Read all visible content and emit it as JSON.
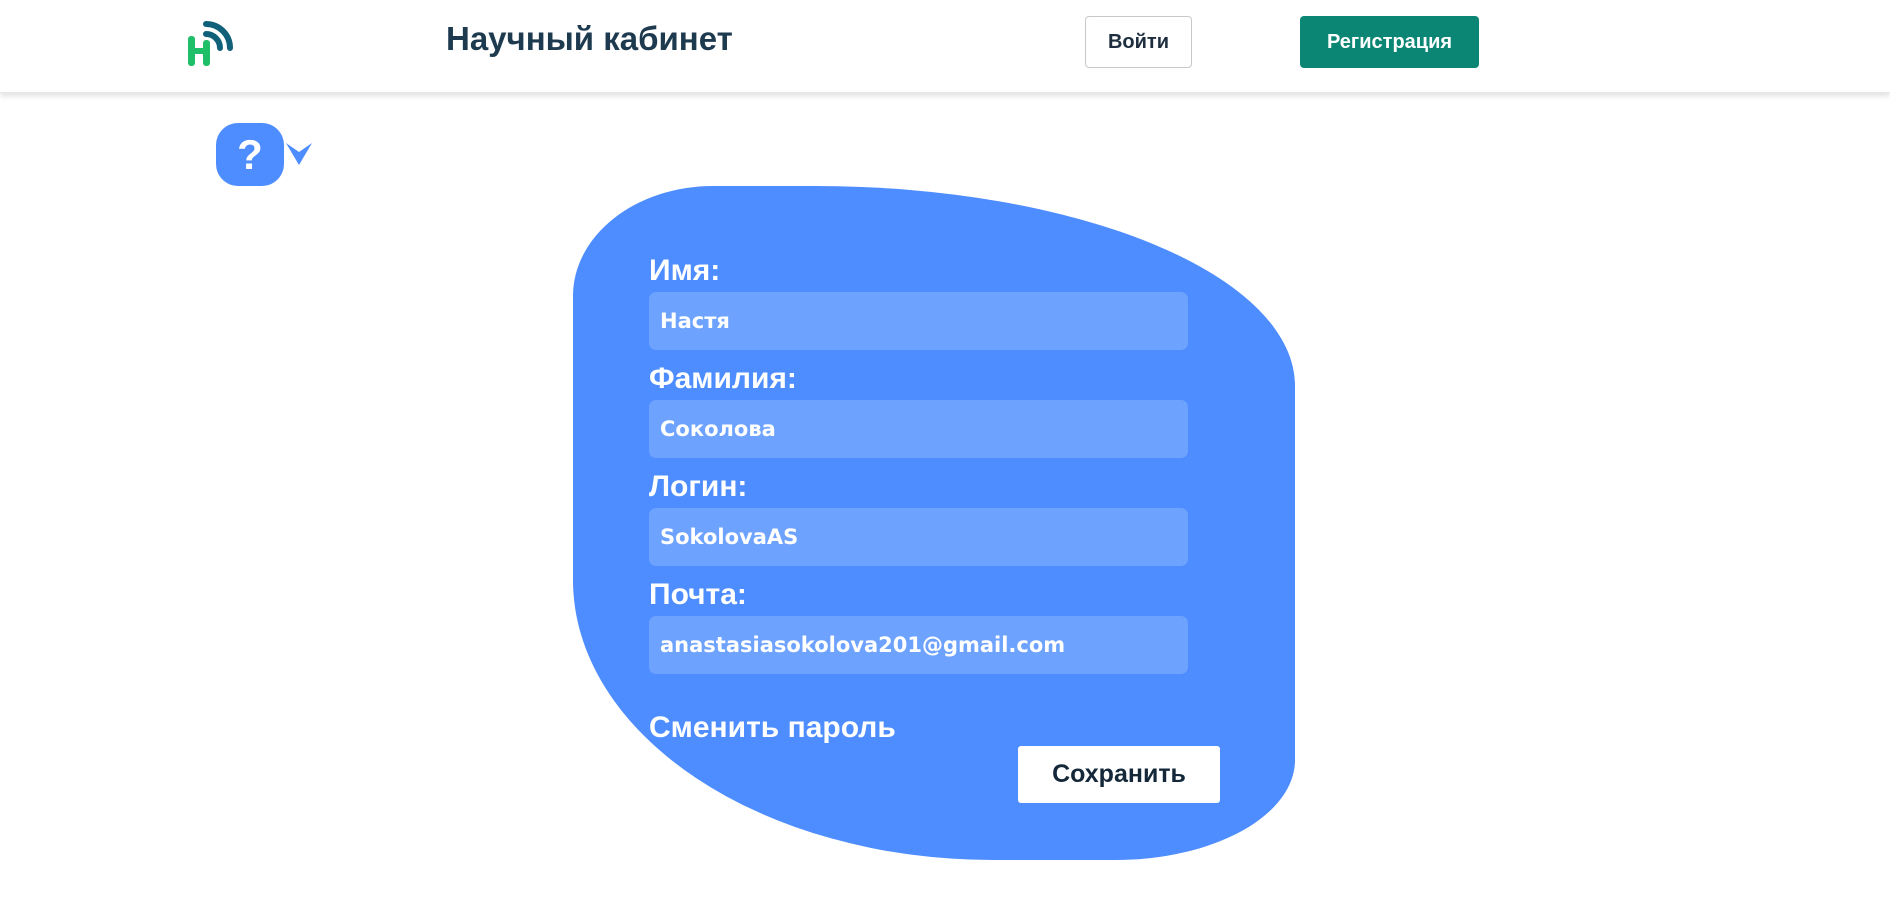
{
  "header": {
    "title": "Научный кабинет",
    "login_label": "Войти",
    "register_label": "Регистрация",
    "logo_letter": "Н"
  },
  "help": {
    "symbol": "?"
  },
  "profile": {
    "fields": [
      {
        "label": "Имя:",
        "value": "Настя"
      },
      {
        "label": "Фамилия:",
        "value": "Соколова"
      },
      {
        "label": "Логин:",
        "value": "SokolovaAS"
      },
      {
        "label": "Почта:",
        "value": "anastasiasokolova201@gmail.com"
      }
    ],
    "change_password_label": "Сменить пароль",
    "save_label": "Сохранить"
  },
  "colors": {
    "card": "#4e8dff",
    "input": "#6da2ff",
    "register": "#0b8574",
    "title": "#1e3a4f",
    "logo_green": "#1fbf6a",
    "logo_teal": "#10607a"
  },
  "icons": {
    "logo": "signal-h-logo-icon",
    "help": "question-icon",
    "chevron": "chevron-down-icon"
  }
}
